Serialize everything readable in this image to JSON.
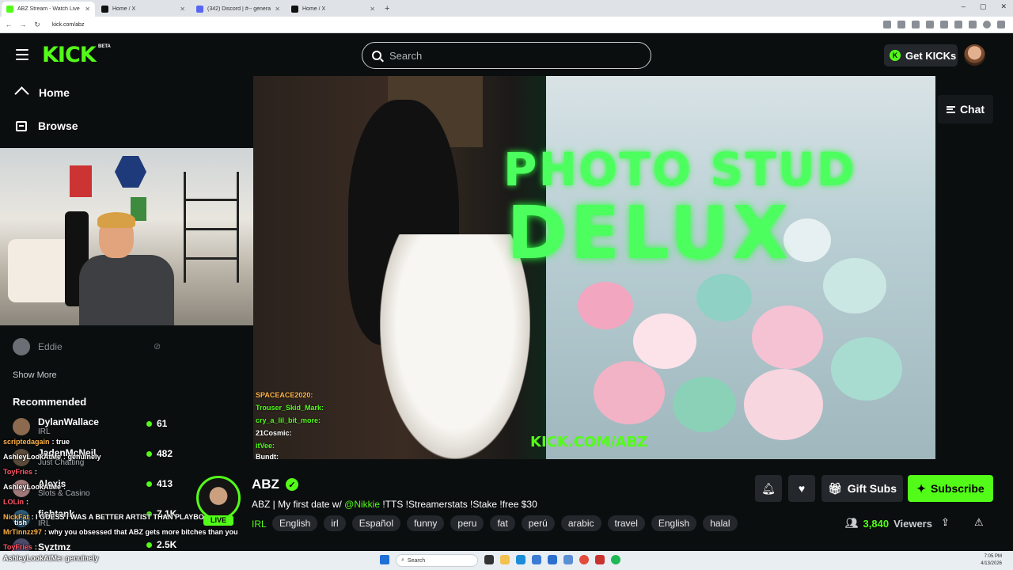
{
  "browser": {
    "tabs": [
      {
        "title": "ABZ Stream - Watch Live o",
        "active": true
      },
      {
        "title": "Home / X",
        "active": false
      },
      {
        "title": "(342) Discord | #-- general |",
        "active": false
      },
      {
        "title": "Home / X",
        "active": false
      }
    ],
    "url": "kick.com/abz"
  },
  "header": {
    "logo": "KICK",
    "beta": "BETA",
    "search_placeholder": "Search",
    "get_kicks_label": "Get KICKs"
  },
  "sidebar": {
    "nav": [
      {
        "label": "Home"
      },
      {
        "label": "Browse"
      }
    ],
    "following": {
      "name": "Eddie"
    },
    "show_more": "Show More",
    "recommended_title": "Recommended",
    "recommended": [
      {
        "name": "DylanWallace",
        "category": "IRL",
        "viewers": "61"
      },
      {
        "name": "JadenMcNeil",
        "category": "Just Chatting",
        "viewers": "482"
      },
      {
        "name": "Alexis",
        "category": "Slots & Casino",
        "viewers": "413"
      },
      {
        "name": "fishtank",
        "category": "IRL",
        "viewers": "7.1K"
      },
      {
        "name": "Syztmz",
        "category": "",
        "viewers": "2.5K"
      }
    ]
  },
  "overlay_chat": [
    {
      "user": "scriptedagain",
      "text": ": true",
      "color": "#ffb347"
    },
    {
      "user": "AshleyLookAtMe",
      "text": ": genuinely",
      "color": "#ffffff"
    },
    {
      "user": "ToyFries",
      "text": ":",
      "color": "#ff5566"
    },
    {
      "user": "AshleyLookAtMe",
      "text": ":",
      "color": "#ffffff"
    },
    {
      "user": "LOLin",
      "text": ":",
      "color": "#ff5566"
    },
    {
      "user": "tish",
      "text": "",
      "color": "#ffffff"
    },
    {
      "user": "NickFat",
      "text": ": I GUESS I WAS A BETTER ARTIST THAN PLAYBOYMAX",
      "color": "#ffb347"
    },
    {
      "user": "MrTinnzz97",
      "text": ": why you obsessed that ABZ gets more bitches than you",
      "color": "#ffb347"
    },
    {
      "user": "ToyFries",
      "text": ":",
      "color": "#ff5566"
    },
    {
      "user": "AshleyLookAtMe",
      "text": ": genuinely",
      "color": "#ffffff"
    }
  ],
  "video": {
    "neon_line1": "PHOTO STUD",
    "neon_line2": "DELUX",
    "watermark": "KICK.COM/ABZ",
    "onscreen_chat": [
      {
        "text": "SPACEACE2020:"
      },
      {
        "text": "Trouser_Skid_Mark:"
      },
      {
        "text": "cry_a_lil_bit_more:"
      },
      {
        "text": "21Cosmic:"
      },
      {
        "text": "itVee:"
      },
      {
        "text": "Bundt:"
      }
    ]
  },
  "chat_toggle_label": "Chat",
  "stream": {
    "streamer": "ABZ",
    "live_label": "LIVE",
    "title_prefix": "ABZ | My first date w/ ",
    "mention": "@Nikkie",
    "title_suffix": " !TTS !Streamerstats !Stake !free $30",
    "category": "IRL",
    "tags": [
      "English",
      "irl",
      "Español",
      "funny",
      "peru",
      "fat",
      "perú",
      "arabic",
      "travel",
      "English",
      "halal"
    ],
    "viewers_count": "3,840",
    "viewers_label": "Viewers",
    "gift_label": "Gift Subs",
    "subscribe_label": "Subscribe"
  },
  "taskbar": {
    "search_label": "Search",
    "time": "7:05 PM",
    "date": "4/13/2026"
  },
  "colors": {
    "accent": "#53fc18",
    "background": "#0b0e0f",
    "surface": "#24272c"
  },
  "icons": [
    "menu-icon",
    "search-icon",
    "home-icon",
    "browse-icon",
    "bell-icon",
    "heart-icon",
    "gift-icon",
    "share-icon",
    "report-icon",
    "chat-icon",
    "verified-icon",
    "viewers-icon"
  ]
}
